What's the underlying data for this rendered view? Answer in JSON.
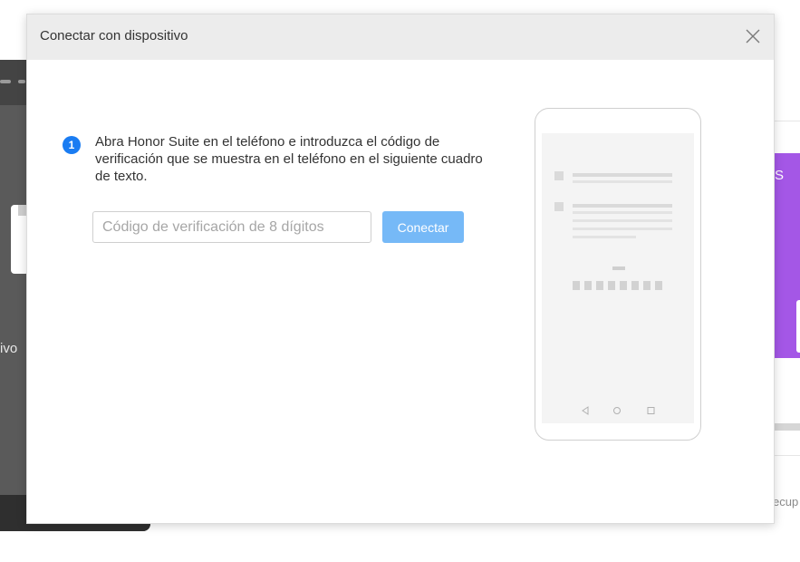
{
  "background": {
    "left_label": "ivo",
    "right_label": "S",
    "bottom_right_label": "ecup"
  },
  "dialog": {
    "title": "Conectar con dispositivo",
    "close_icon": "close-icon",
    "step_number": "1",
    "instruction": "Abra Honor Suite en el teléfono e introduzca el código de verificación que se muestra en el teléfono en el siguiente cuadro de texto.",
    "input_placeholder": "Código de verificación de 8 dígitos",
    "input_value": "",
    "connect_label": "Conectar"
  },
  "phone_illustration": {
    "nav_icons": [
      "back-icon",
      "home-icon",
      "recents-icon"
    ],
    "code_boxes": 8
  },
  "colors": {
    "accent": "#1a7cf2",
    "button_disabled": "#76b9f7",
    "header_bg": "#ececec",
    "purple": "#a457e6"
  }
}
